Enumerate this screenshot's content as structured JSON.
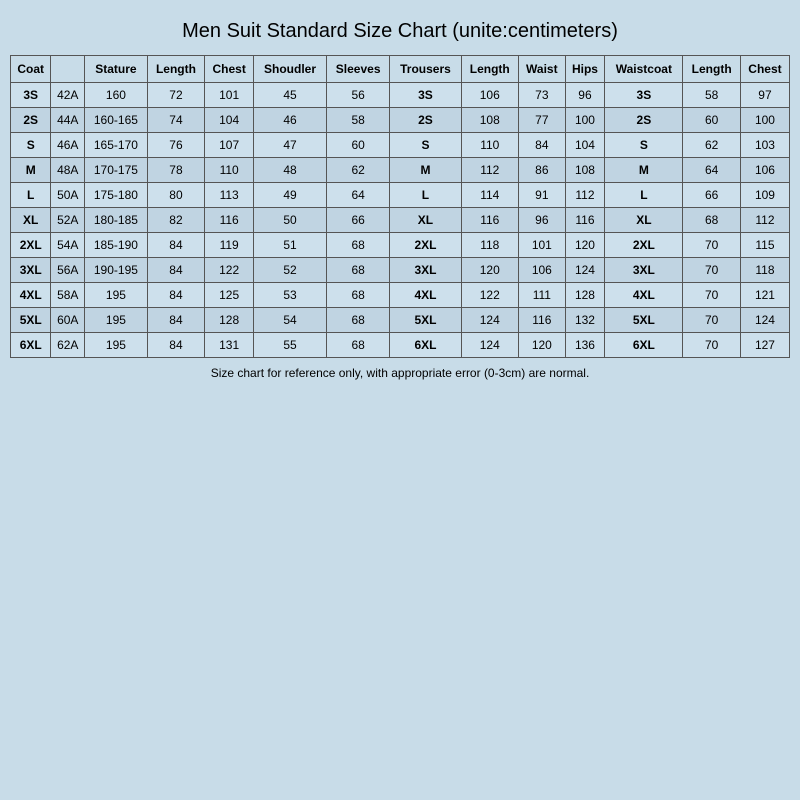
{
  "title": "Men Suit Standard Size Chart   (unite:centimeters)",
  "footer": "Size chart for reference only, with appropriate error (0-3cm) are normal.",
  "headers": {
    "coat": "Coat",
    "stature": "Stature",
    "length1": "Length",
    "chest": "Chest",
    "shoulder": "Shoudler",
    "sleeves": "Sleeves",
    "trousers": "Trousers",
    "length2": "Length",
    "waist": "Waist",
    "hips": "Hips",
    "waistcoat": "Waistcoat",
    "length3": "Length",
    "chest2": "Chest"
  },
  "rows": [
    {
      "coat": "3S",
      "model": "42A",
      "stature": "160",
      "length1": "72",
      "chest": "101",
      "shoulder": "45",
      "sleeves": "56",
      "trousers": "3S",
      "length2": "106",
      "waist": "73",
      "hips": "96",
      "waistcoat": "3S",
      "length3": "58",
      "chest2": "97"
    },
    {
      "coat": "2S",
      "model": "44A",
      "stature": "160-165",
      "length1": "74",
      "chest": "104",
      "shoulder": "46",
      "sleeves": "58",
      "trousers": "2S",
      "length2": "108",
      "waist": "77",
      "hips": "100",
      "waistcoat": "2S",
      "length3": "60",
      "chest2": "100"
    },
    {
      "coat": "S",
      "model": "46A",
      "stature": "165-170",
      "length1": "76",
      "chest": "107",
      "shoulder": "47",
      "sleeves": "60",
      "trousers": "S",
      "length2": "110",
      "waist": "84",
      "hips": "104",
      "waistcoat": "S",
      "length3": "62",
      "chest2": "103"
    },
    {
      "coat": "M",
      "model": "48A",
      "stature": "170-175",
      "length1": "78",
      "chest": "110",
      "shoulder": "48",
      "sleeves": "62",
      "trousers": "M",
      "length2": "112",
      "waist": "86",
      "hips": "108",
      "waistcoat": "M",
      "length3": "64",
      "chest2": "106"
    },
    {
      "coat": "L",
      "model": "50A",
      "stature": "175-180",
      "length1": "80",
      "chest": "113",
      "shoulder": "49",
      "sleeves": "64",
      "trousers": "L",
      "length2": "114",
      "waist": "91",
      "hips": "112",
      "waistcoat": "L",
      "length3": "66",
      "chest2": "109"
    },
    {
      "coat": "XL",
      "model": "52A",
      "stature": "180-185",
      "length1": "82",
      "chest": "116",
      "shoulder": "50",
      "sleeves": "66",
      "trousers": "XL",
      "length2": "116",
      "waist": "96",
      "hips": "116",
      "waistcoat": "XL",
      "length3": "68",
      "chest2": "112"
    },
    {
      "coat": "2XL",
      "model": "54A",
      "stature": "185-190",
      "length1": "84",
      "chest": "119",
      "shoulder": "51",
      "sleeves": "68",
      "trousers": "2XL",
      "length2": "118",
      "waist": "101",
      "hips": "120",
      "waistcoat": "2XL",
      "length3": "70",
      "chest2": "115"
    },
    {
      "coat": "3XL",
      "model": "56A",
      "stature": "190-195",
      "length1": "84",
      "chest": "122",
      "shoulder": "52",
      "sleeves": "68",
      "trousers": "3XL",
      "length2": "120",
      "waist": "106",
      "hips": "124",
      "waistcoat": "3XL",
      "length3": "70",
      "chest2": "118"
    },
    {
      "coat": "4XL",
      "model": "58A",
      "stature": "195",
      "length1": "84",
      "chest": "125",
      "shoulder": "53",
      "sleeves": "68",
      "trousers": "4XL",
      "length2": "122",
      "waist": "111",
      "hips": "128",
      "waistcoat": "4XL",
      "length3": "70",
      "chest2": "121"
    },
    {
      "coat": "5XL",
      "model": "60A",
      "stature": "195",
      "length1": "84",
      "chest": "128",
      "shoulder": "54",
      "sleeves": "68",
      "trousers": "5XL",
      "length2": "124",
      "waist": "116",
      "hips": "132",
      "waistcoat": "5XL",
      "length3": "70",
      "chest2": "124"
    },
    {
      "coat": "6XL",
      "model": "62A",
      "stature": "195",
      "length1": "84",
      "chest": "131",
      "shoulder": "55",
      "sleeves": "68",
      "trousers": "6XL",
      "length2": "124",
      "waist": "120",
      "hips": "136",
      "waistcoat": "6XL",
      "length3": "70",
      "chest2": "127"
    }
  ]
}
